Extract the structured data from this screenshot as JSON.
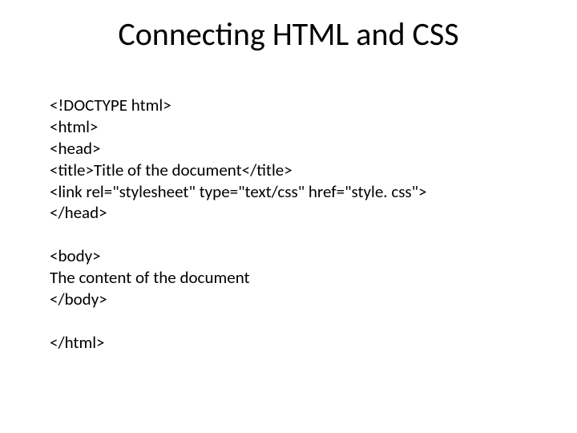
{
  "title": "Connecting HTML and CSS",
  "lines": {
    "l1": "<!DOCTYPE html>",
    "l2": "<html>",
    "l3": "<head>",
    "l4": "<title>Title of the document</title>",
    "l5": "<link rel=\"stylesheet\" type=\"text/css\" href=\"style. css\">",
    "l6": "</head>",
    "l7": "<body>",
    "l8": "The content of the document",
    "l9": "</body>",
    "l10": "</html>"
  }
}
